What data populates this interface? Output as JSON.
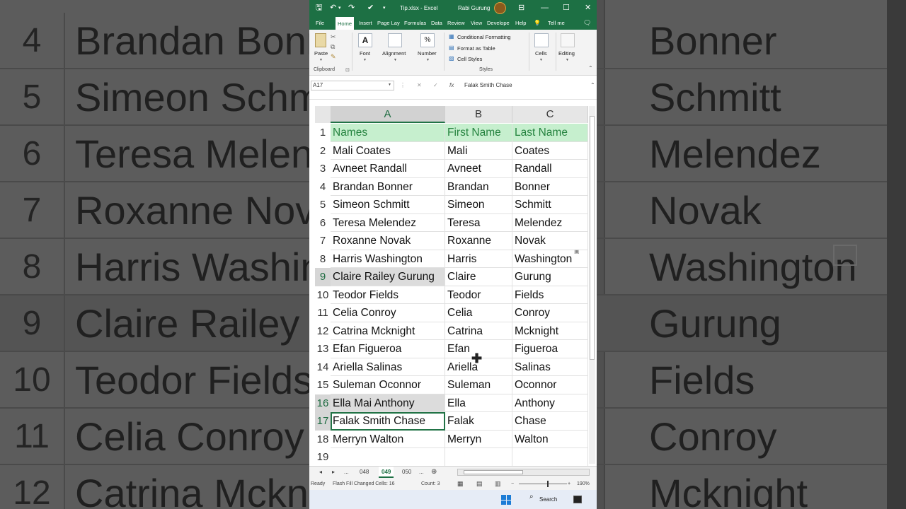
{
  "background": {
    "left_rows": [
      {
        "num": "4",
        "text": "Brandan Bonn",
        "highlight": false
      },
      {
        "num": "5",
        "text": "Simeon Schmi",
        "highlight": false
      },
      {
        "num": "6",
        "text": "Teresa Melen",
        "highlight": false
      },
      {
        "num": "7",
        "text": "Roxanne Nova",
        "highlight": false
      },
      {
        "num": "8",
        "text": "Harris Washin",
        "highlight": false
      },
      {
        "num": "9",
        "text": "Claire Railey G",
        "highlight": true
      },
      {
        "num": "10",
        "text": "Teodor Fields",
        "highlight": false
      },
      {
        "num": "11",
        "text": "Celia Conroy",
        "highlight": false
      },
      {
        "num": "12",
        "text": "Catrina Mckni",
        "highlight": false
      }
    ],
    "right_rows": [
      "Bonner",
      "Schmitt",
      "Melendez",
      "Novak",
      "Washington",
      "Gurung",
      "Fields",
      "Conroy",
      "Mcknight"
    ]
  },
  "titlebar": {
    "filename": "Tip.xlsx  -  Excel",
    "user": "Rabi Gurung",
    "save_icon": "🖫",
    "undo_icon": "↶",
    "redo_icon": "↷",
    "check_icon": "✔",
    "more_icon": "▾",
    "ribbon_display_icon": "⊟",
    "minimize_icon": "—",
    "maximize_icon": "☐",
    "close_icon": "✕"
  },
  "tabs": [
    "File",
    "Home",
    "Insert",
    "Page Lay",
    "Formulas",
    "Data",
    "Review",
    "View",
    "Develope",
    "Help"
  ],
  "tell_me": "Tell me",
  "lightbulb_icon": "💡",
  "comment_icon": "🗨",
  "ribbon": {
    "paste": "Paste",
    "clipboard": "Clipboard",
    "font": "Font",
    "alignment": "Alignment",
    "number": "Number",
    "number_symbol": "%",
    "conditional_formatting": "Conditional Formatting",
    "format_as_table": "Format as Table",
    "cell_styles": "Cell Styles",
    "styles": "Styles",
    "cells": "Cells",
    "editing": "Editing",
    "font_letter": "A"
  },
  "formula_bar": {
    "name_box": "A17",
    "cancel": "✕",
    "enter": "✓",
    "fx": "fx",
    "content": "Falak Smith Chase"
  },
  "columns": [
    "A",
    "B",
    "C"
  ],
  "rows": [
    {
      "n": "1",
      "a": "Names",
      "b": "First Name",
      "c": "Last Name"
    },
    {
      "n": "2",
      "a": "Mali Coates",
      "b": "Mali",
      "c": "Coates"
    },
    {
      "n": "3",
      "a": "Avneet Randall",
      "b": "Avneet",
      "c": "Randall"
    },
    {
      "n": "4",
      "a": "Brandan Bonner",
      "b": "Brandan",
      "c": "Bonner"
    },
    {
      "n": "5",
      "a": "Simeon Schmitt",
      "b": "Simeon",
      "c": "Schmitt"
    },
    {
      "n": "6",
      "a": "Teresa Melendez",
      "b": "Teresa",
      "c": "Melendez"
    },
    {
      "n": "7",
      "a": "Roxanne Novak",
      "b": "Roxanne",
      "c": "Novak"
    },
    {
      "n": "8",
      "a": "Harris Washington",
      "b": "Harris",
      "c": "Washington"
    },
    {
      "n": "9",
      "a": "Claire Railey Gurung",
      "b": "Claire",
      "c": "Gurung"
    },
    {
      "n": "10",
      "a": "Teodor Fields",
      "b": "Teodor",
      "c": "Fields"
    },
    {
      "n": "11",
      "a": "Celia Conroy",
      "b": "Celia",
      "c": "Conroy"
    },
    {
      "n": "12",
      "a": "Catrina Mcknight",
      "b": "Catrina",
      "c": "Mcknight"
    },
    {
      "n": "13",
      "a": "Efan Figueroa",
      "b": "Efan",
      "c": "Figueroa"
    },
    {
      "n": "14",
      "a": "Ariella Salinas",
      "b": "Ariella",
      "c": "Salinas"
    },
    {
      "n": "15",
      "a": "Suleman Oconnor",
      "b": "Suleman",
      "c": "Oconnor"
    },
    {
      "n": "16",
      "a": "Ella Mai Anthony",
      "b": "Ella",
      "c": "Anthony"
    },
    {
      "n": "17",
      "a": "Falak Smith Chase",
      "b": "Falak",
      "c": "Chase"
    },
    {
      "n": "18",
      "a": "Merryn Walton",
      "b": "Merryn",
      "c": "Walton"
    },
    {
      "n": "19",
      "a": "",
      "b": "",
      "c": ""
    }
  ],
  "sheets": {
    "prev": "◂",
    "next": "▸",
    "ellipsis": "...",
    "tab1": "048",
    "tab2": "049",
    "tab3": "050",
    "add": "⊕"
  },
  "status": {
    "ready": "Ready",
    "flash_fill": "Flash Fill Changed Cells: 16",
    "count": "Count: 3",
    "zoom": "190%",
    "zoom_minus": "−",
    "zoom_plus": "+"
  },
  "taskbar": {
    "search": "Search",
    "search_icon": "⌕"
  }
}
